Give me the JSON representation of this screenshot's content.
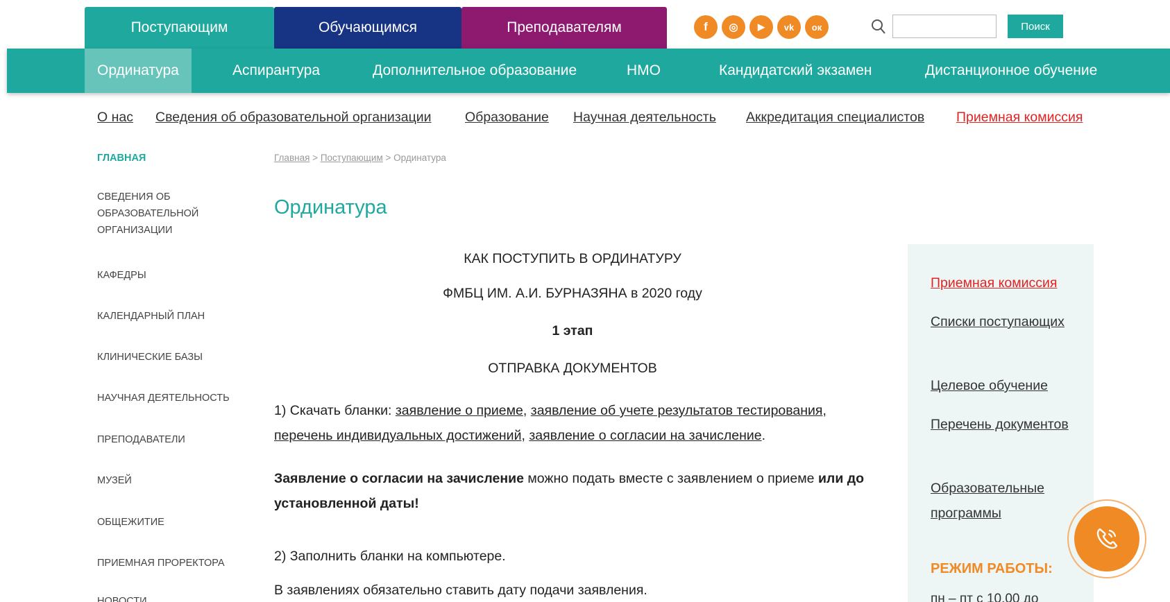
{
  "audience_tabs": [
    "Поступающим",
    "Обучающимся",
    "Преподавателям"
  ],
  "social_icons": [
    "facebook-icon",
    "instagram-icon",
    "youtube-icon",
    "vk-icon",
    "odnoklassniki-icon"
  ],
  "social_glyphs": {
    "facebook": "f",
    "instagram": "◎",
    "youtube": "▶",
    "vk": "vk",
    "odnoklassniki": "ок"
  },
  "search": {
    "placeholder": "",
    "button_label": "Поиск"
  },
  "teal_nav": [
    "Ординатура",
    "Аспирантура",
    "Дополнительное образование",
    "НМО",
    "Кандидатский экзамен",
    "Дистанционное обучение"
  ],
  "secondary_nav": [
    "О нас",
    "Сведения об образовательной организации",
    "Образование",
    "Научная деятельность",
    "Аккредитация специалистов",
    "Приемная комиссия"
  ],
  "sidebar": [
    "Главная",
    "Сведения об образовательной организации",
    "Кафедры",
    "Календарный план",
    "Клинические базы",
    "Научная деятельность",
    "Преподаватели",
    "Музей",
    "Общежитие",
    "Приемная проректора",
    "Новости"
  ],
  "breadcrumb": {
    "home": "Главная",
    "sep": ">",
    "section": "Поступающим",
    "current": "Ординатура"
  },
  "page_title": "Ординатура",
  "article": {
    "heading1": "КАК ПОСТУПИТЬ В ОРДИНАТУРУ",
    "heading2": "ФМБЦ ИМ. А.И. БУРНАЗЯНА в 2020 году",
    "stage": "1 этап",
    "stage_title": "ОТПРАВКА ДОКУМЕНТОВ",
    "step1_prefix": "1) Скачать бланки: ",
    "step1_links": [
      "заявление о приеме",
      "заявление об учете результатов тестирования",
      "перечень индивидуальных достижений",
      "заявление о согласии на зачисление"
    ],
    "comma": ",",
    "dot": ".",
    "note_bold1": "Заявление о согласии на зачисление",
    "note_mid": " можно подать вместе с заявлением о приеме ",
    "note_bold2": "или до установленной даты!",
    "step2": "2) Заполнить бланки на компьютере.",
    "step2_note": "В заявлениях обязательно ставить дату подачи заявления."
  },
  "right_box": {
    "links": [
      "Приемная комиссия",
      "Списки поступающих",
      "Целевое обучение",
      "Перечень документов",
      "Образовательные программы"
    ],
    "hours_title": "РЕЖИМ РАБОТЫ:",
    "hours_text": "пн – пт с 10.00 до"
  },
  "colors": {
    "teal": "#1fa99e",
    "navy": "#173384",
    "purple": "#8d1a6f",
    "orange": "#f08a25",
    "red": "#e02424"
  }
}
